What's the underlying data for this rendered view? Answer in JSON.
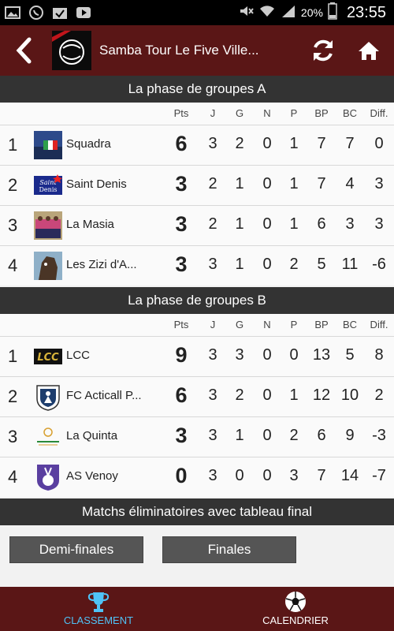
{
  "status_bar": {
    "battery": "20%",
    "time": "23:55"
  },
  "app_bar": {
    "title": "Samba Tour Le Five Ville..."
  },
  "columns": [
    "Pts",
    "J",
    "G",
    "N",
    "P",
    "BP",
    "BC",
    "Diff."
  ],
  "groups": [
    {
      "title": "La phase de groupes A",
      "teams": [
        {
          "rank": "1",
          "name": "Squadra",
          "pts": "6",
          "j": "3",
          "g": "2",
          "n": "0",
          "p": "1",
          "bp": "7",
          "bc": "7",
          "diff": "0"
        },
        {
          "rank": "2",
          "name": "Saint Denis",
          "pts": "3",
          "j": "2",
          "g": "1",
          "n": "0",
          "p": "1",
          "bp": "7",
          "bc": "4",
          "diff": "3"
        },
        {
          "rank": "3",
          "name": "La Masia",
          "pts": "3",
          "j": "2",
          "g": "1",
          "n": "0",
          "p": "1",
          "bp": "6",
          "bc": "3",
          "diff": "3"
        },
        {
          "rank": "4",
          "name": "Les Zizi d'A...",
          "pts": "3",
          "j": "3",
          "g": "1",
          "n": "0",
          "p": "2",
          "bp": "5",
          "bc": "11",
          "diff": "-6"
        }
      ]
    },
    {
      "title": "La phase de groupes B",
      "teams": [
        {
          "rank": "1",
          "name": "LCC",
          "pts": "9",
          "j": "3",
          "g": "3",
          "n": "0",
          "p": "0",
          "bp": "13",
          "bc": "5",
          "diff": "8"
        },
        {
          "rank": "2",
          "name": "FC Acticall P...",
          "pts": "6",
          "j": "3",
          "g": "2",
          "n": "0",
          "p": "1",
          "bp": "12",
          "bc": "10",
          "diff": "2"
        },
        {
          "rank": "3",
          "name": "La Quinta",
          "pts": "3",
          "j": "3",
          "g": "1",
          "n": "0",
          "p": "2",
          "bp": "6",
          "bc": "9",
          "diff": "-3"
        },
        {
          "rank": "4",
          "name": "AS Venoy",
          "pts": "0",
          "j": "3",
          "g": "0",
          "n": "0",
          "p": "3",
          "bp": "7",
          "bc": "14",
          "diff": "-7"
        }
      ]
    }
  ],
  "knockout": {
    "title": "Matchs éliminatoires avec tableau final",
    "semi_label": "Demi-finales",
    "final_label": "Finales"
  },
  "bottom_nav": {
    "standings_label": "CLASSEMENT",
    "calendar_label": "CALENDRIER",
    "active_color": "#4fc3f7"
  },
  "team_logo_text": {
    "saint_denis": "Saint Denis",
    "lcc": "LCC"
  }
}
